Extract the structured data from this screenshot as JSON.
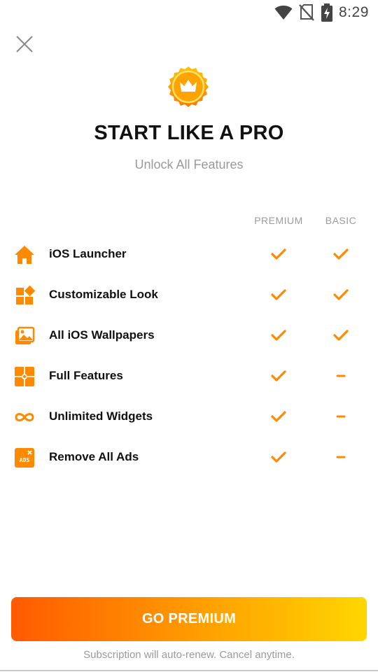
{
  "status_bar": {
    "time": "8:29",
    "icons": [
      "wifi-icon",
      "no-sim-icon",
      "battery-charging-icon"
    ]
  },
  "header": {
    "title": "START LIKE A PRO",
    "subtitle": "Unlock All Features",
    "badge_icon": "crown-icon"
  },
  "columns": {
    "premium": "PREMIUM",
    "basic": "BASIC"
  },
  "features": [
    {
      "label": "iOS Launcher",
      "icon": "home-icon",
      "premium": "check",
      "basic": "check"
    },
    {
      "label": "Customizable Look",
      "icon": "widgets-icon",
      "premium": "check",
      "basic": "check"
    },
    {
      "label": "All iOS Wallpapers",
      "icon": "wallpaper-icon",
      "premium": "check",
      "basic": "check"
    },
    {
      "label": "Full Features",
      "icon": "puzzle-icon",
      "premium": "check",
      "basic": "dash"
    },
    {
      "label": "Unlimited Widgets",
      "icon": "infinity-icon",
      "premium": "check",
      "basic": "dash"
    },
    {
      "label": "Remove All Ads",
      "icon": "ads-icon",
      "premium": "check",
      "basic": "dash"
    }
  ],
  "cta": {
    "label": "GO PREMIUM"
  },
  "footnote": "Subscription will auto-renew. Cancel anytime.",
  "colors": {
    "accent": "#ff8a00",
    "gradient_start": "#ff5a00",
    "gradient_end": "#ffd600",
    "muted_text": "#9a9a9a"
  }
}
